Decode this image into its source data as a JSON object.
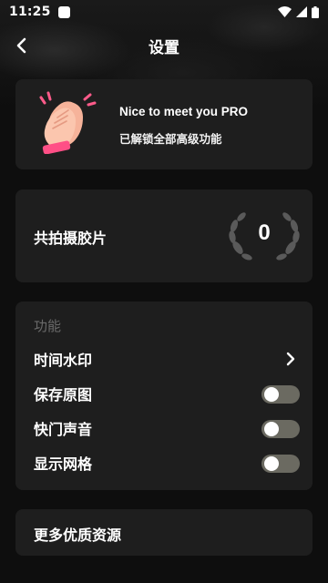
{
  "status_bar": {
    "time": "11:25"
  },
  "nav": {
    "title": "设置"
  },
  "pro_card": {
    "emoji": "clapping-hands",
    "title": "Nice to meet you PRO",
    "subtitle": "已解锁全部高级功能"
  },
  "photos_card": {
    "label": "共拍摄胶片",
    "count": "0"
  },
  "functions": {
    "section_label": "功能",
    "items": [
      {
        "label": "时间水印",
        "control": "chevron"
      },
      {
        "label": "保存原图",
        "control": "toggle",
        "enabled": false
      },
      {
        "label": "快门声音",
        "control": "toggle",
        "enabled": false
      },
      {
        "label": "显示网格",
        "control": "toggle",
        "enabled": false
      }
    ]
  },
  "more": {
    "label": "更多优质资源"
  },
  "colors": {
    "background": "#0e0e0e",
    "card": "#1e1e1e",
    "toggle_off": "#6b6a61",
    "section_label": "#6a6a6a"
  }
}
